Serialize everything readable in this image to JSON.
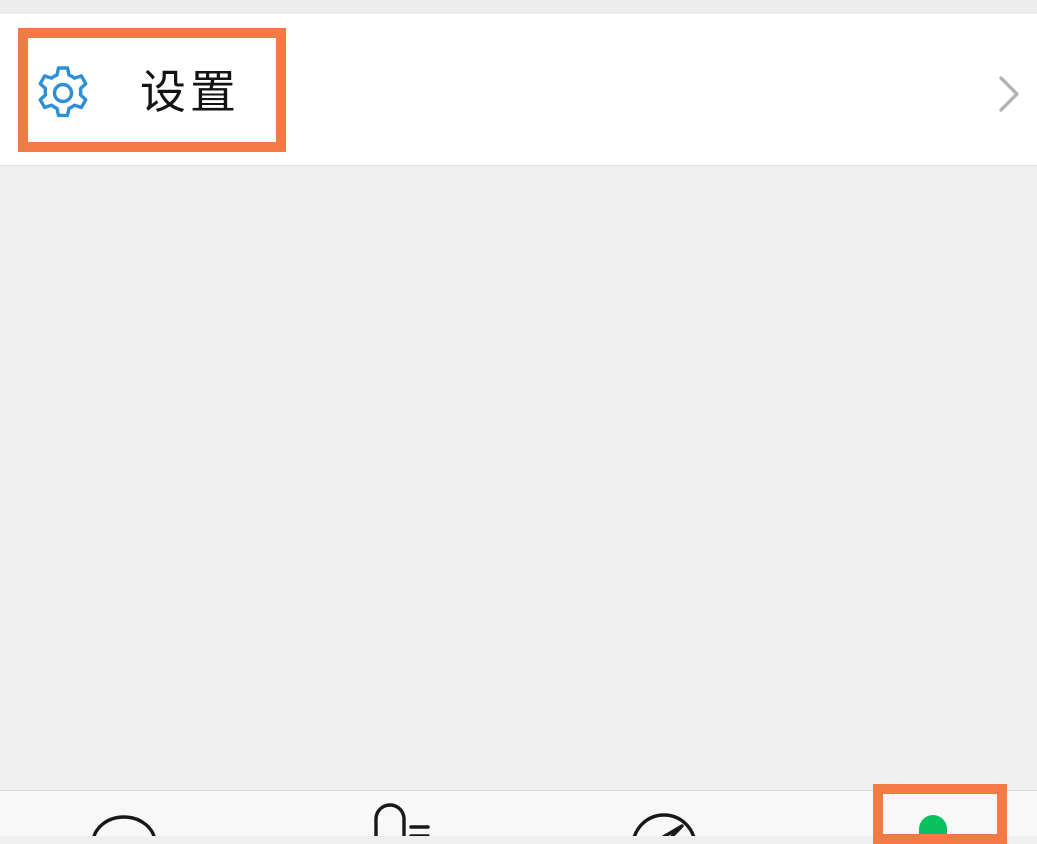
{
  "settings_row": {
    "label": "设置",
    "icon": "gear-icon",
    "icon_color": "#2d8fd5",
    "chevron_icon": "chevron-right-icon"
  },
  "tabbar": {
    "tabs": [
      {
        "icon": "chat-bubble-icon",
        "active": false
      },
      {
        "icon": "contacts-icon",
        "active": false
      },
      {
        "icon": "compass-icon",
        "active": false
      },
      {
        "icon": "me-icon",
        "active": true
      }
    ],
    "active_color": "#07c160"
  },
  "highlight_color": "#f47a45"
}
